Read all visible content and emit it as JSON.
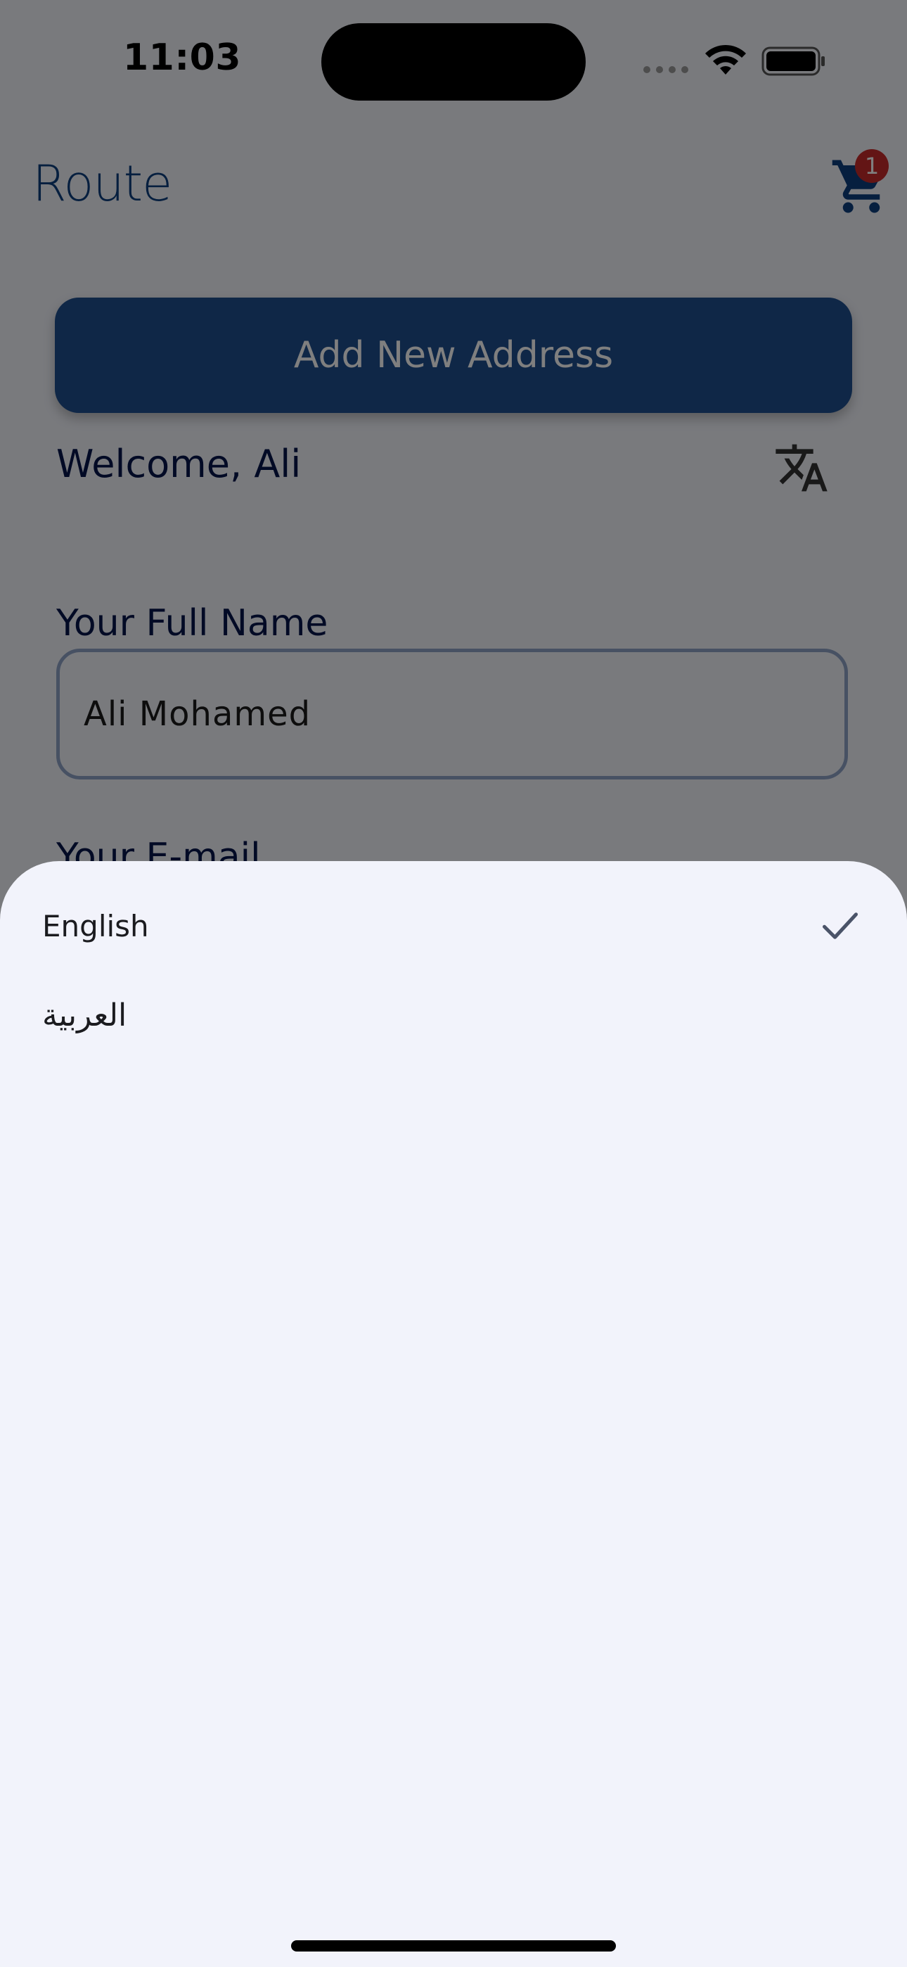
{
  "status_bar": {
    "time": "11:03"
  },
  "header": {
    "logo_text": "Route",
    "cart_count": "1"
  },
  "main": {
    "add_address_label": "Add New Address",
    "welcome_text": "Welcome, Ali",
    "full_name_label": "Your Full Name",
    "full_name_value": "Ali Mohamed",
    "email_label": "Your E-mail"
  },
  "language_sheet": {
    "options": [
      {
        "label": "English",
        "selected": true
      },
      {
        "label": "العربية",
        "selected": false
      }
    ]
  },
  "colors": {
    "primary": "#1f4e8f",
    "heading": "#04144a",
    "badge": "#c62b2b",
    "sheet_background": "#f2f3fb"
  },
  "icons": {
    "cart": "cart-icon",
    "translate": "translate-icon",
    "check": "check-icon",
    "wifi": "wifi-icon",
    "battery": "battery-icon"
  }
}
